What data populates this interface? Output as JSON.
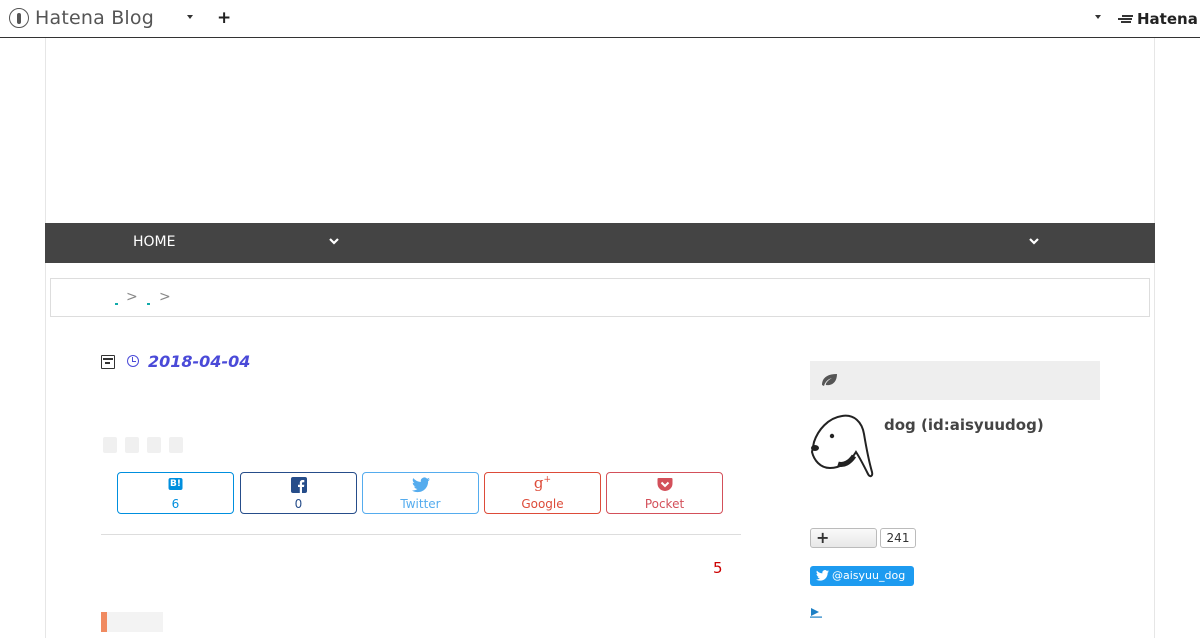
{
  "topbar": {
    "brand": "Hatena Blog",
    "add_label": "+",
    "hatena_logo": "Hatena"
  },
  "nav": {
    "home_label": "HOME"
  },
  "breadcrumb": {
    "separators": [
      ">",
      ">"
    ]
  },
  "article": {
    "date": "2018-04-04",
    "share": {
      "hatena": {
        "icon": "B!",
        "label": "6",
        "color": "#008fde"
      },
      "facebook": {
        "label": "0",
        "color": "#264d8a"
      },
      "twitter": {
        "label": "Twitter",
        "color": "#55acee"
      },
      "google": {
        "label": "Google",
        "color": "#dd4b39"
      },
      "pocket": {
        "label": "Pocket",
        "color": "#d3505a"
      }
    },
    "comment_count": "5"
  },
  "sidebar": {
    "profile_name": "dog (id:aisyuudog)",
    "follow_label": "+",
    "follower_count": "241",
    "twitter_handle": "@aisyuu_dog"
  },
  "colors": {
    "accent": "#4a4ad8",
    "nav_bg": "#444444",
    "twitter": "#1d9bf0"
  }
}
